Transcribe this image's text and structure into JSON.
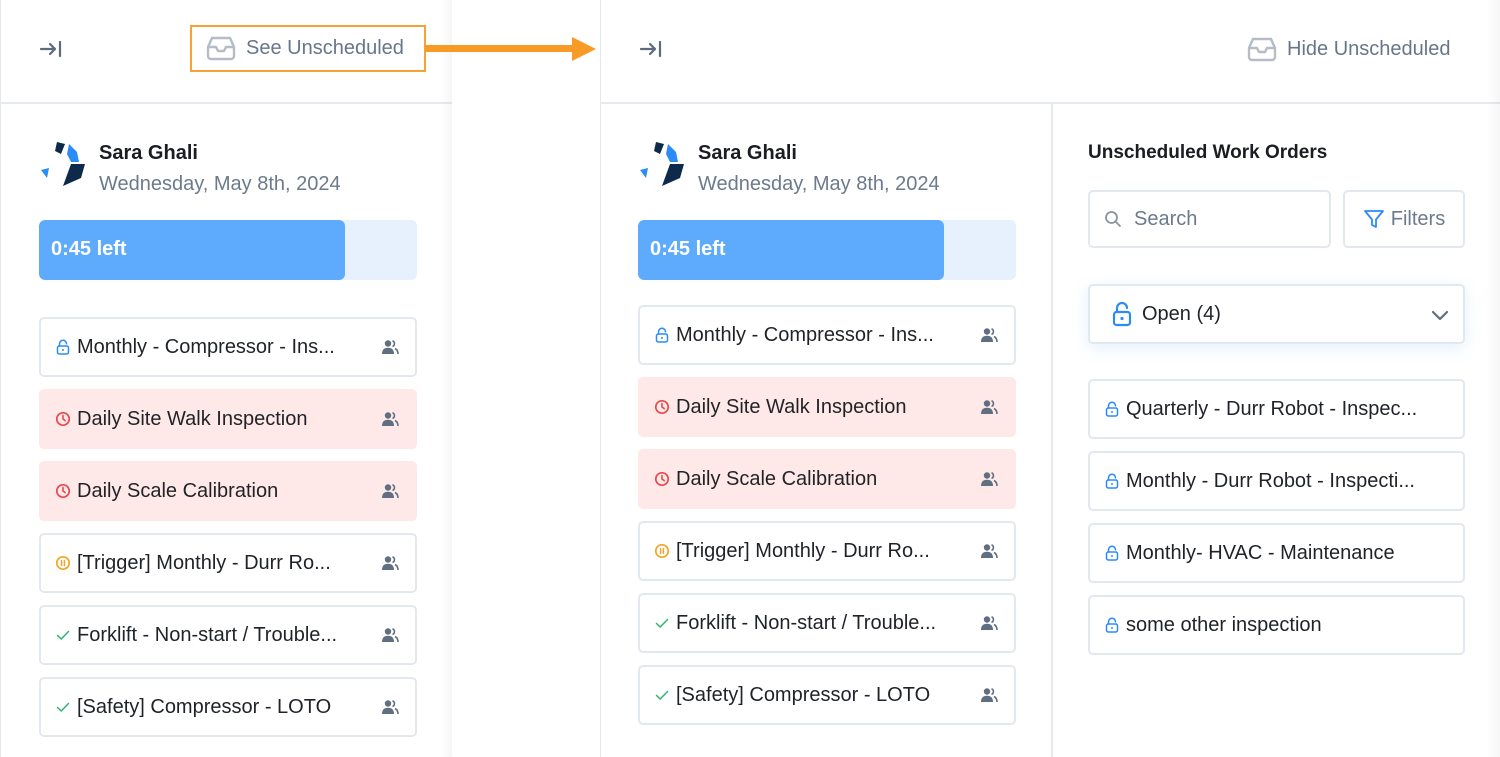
{
  "annotation": {
    "highlight_color": "#f7a234",
    "arrow_color": "#f89b26"
  },
  "before": {
    "collapse_icon": "collapse-right-icon",
    "toggle_label": "See Unscheduled",
    "toggle_icon": "inbox-icon",
    "user": {
      "name": "Sara Ghali",
      "date": "Wednesday, May 8th, 2024"
    },
    "progress": {
      "label": "0:45 left",
      "fraction_filled": 0.81
    },
    "work_orders": [
      {
        "title": "Monthly - Compressor - Ins...",
        "status": "open",
        "assignee_icon": "users-icon"
      },
      {
        "title": "Daily Site Walk Inspection",
        "status": "overdue",
        "assignee_icon": "users-icon"
      },
      {
        "title": "Daily Scale Calibration",
        "status": "overdue",
        "assignee_icon": "users-icon"
      },
      {
        "title": "[Trigger] Monthly - Durr Ro...",
        "status": "on-hold",
        "assignee_icon": "users-icon"
      },
      {
        "title": "Forklift - Non-start / Trouble...",
        "status": "done",
        "assignee_icon": "users-icon"
      },
      {
        "title": "[Safety] Compressor - LOTO",
        "status": "done",
        "assignee_icon": "users-icon"
      }
    ]
  },
  "after": {
    "collapse_icon": "collapse-right-icon",
    "toggle_label": "Hide Unscheduled",
    "toggle_icon": "inbox-icon",
    "user": {
      "name": "Sara Ghali",
      "date": "Wednesday, May 8th, 2024"
    },
    "progress": {
      "label": "0:45 left",
      "fraction_filled": 0.81
    },
    "work_orders": [
      {
        "title": "Monthly - Compressor - Ins...",
        "status": "open"
      },
      {
        "title": "Daily Site Walk Inspection",
        "status": "overdue"
      },
      {
        "title": "Daily Scale Calibration",
        "status": "overdue"
      },
      {
        "title": "[Trigger] Monthly - Durr Ro...",
        "status": "on-hold"
      },
      {
        "title": "Forklift - Non-start / Trouble...",
        "status": "done"
      },
      {
        "title": "[Safety] Compressor - LOTO",
        "status": "done"
      }
    ],
    "unscheduled": {
      "title": "Unscheduled Work Orders",
      "search_placeholder": "Search",
      "filters_label": "Filters",
      "status_filter": "Open (4)",
      "items": [
        {
          "title": "Quarterly - Durr Robot - Inspec...",
          "status": "open"
        },
        {
          "title": "Monthly - Durr Robot - Inspecti...",
          "status": "open"
        },
        {
          "title": "Monthly- HVAC - Maintenance",
          "status": "open"
        },
        {
          "title": "some other inspection",
          "status": "open"
        }
      ]
    }
  },
  "status_colors": {
    "open": "#2b8cf5",
    "overdue": "#e5484d",
    "on-hold": "#f5a524",
    "done": "#2bb673",
    "overdue_bg": "#ffe8e8",
    "progress_fill": "#5eaafc",
    "progress_track": "#e6f1fd"
  }
}
